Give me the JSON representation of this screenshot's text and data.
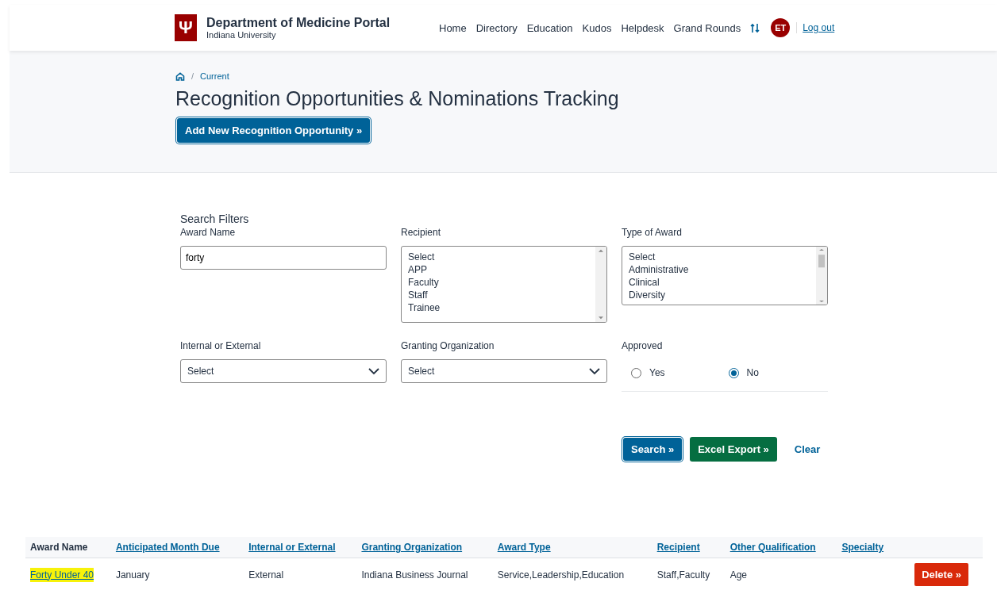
{
  "header": {
    "logo": "Ψ",
    "title": "Department of Medicine Portal",
    "subtitle": "Indiana University",
    "nav": [
      "Home",
      "Directory",
      "Education",
      "Kudos",
      "Helpdesk",
      "Grand Rounds"
    ],
    "avatar": "ET",
    "logout": "Log out"
  },
  "breadcrumb": {
    "separator": "/",
    "current": "Current"
  },
  "page_title": "Recognition Opportunities & Nominations Tracking",
  "add_button": "Add New Recognition Opportunity »",
  "filters": {
    "heading": "Search Filters",
    "award_name": {
      "label": "Award Name",
      "value": "forty"
    },
    "recipient": {
      "label": "Recipient",
      "options": [
        "Select",
        "APP",
        "Faculty",
        "Staff",
        "Trainee"
      ]
    },
    "type_of_award": {
      "label": "Type of Award",
      "options": [
        "Select",
        "Administrative",
        "Clinical",
        "Diversity"
      ]
    },
    "internal_external": {
      "label": "Internal or External",
      "value": "Select"
    },
    "granting_org": {
      "label": "Granting Organization",
      "value": "Select"
    },
    "approved": {
      "label": "Approved",
      "options": [
        {
          "label": "Yes",
          "selected": false
        },
        {
          "label": "No",
          "selected": true
        }
      ]
    }
  },
  "actions": {
    "search": "Search »",
    "export": "Excel Export »",
    "clear": "Clear"
  },
  "table": {
    "columns": [
      {
        "label": "Award Name",
        "sortable": false
      },
      {
        "label": "Anticipated Month Due",
        "sortable": true
      },
      {
        "label": "Internal or External",
        "sortable": true
      },
      {
        "label": "Granting Organization",
        "sortable": true
      },
      {
        "label": "Award Type",
        "sortable": true
      },
      {
        "label": "Recipient",
        "sortable": true
      },
      {
        "label": "Other Qualification",
        "sortable": true
      },
      {
        "label": "Specialty",
        "sortable": true
      }
    ],
    "rows": [
      {
        "highlighted": true,
        "cells": [
          "Forty Under 40",
          "January",
          "External",
          "Indiana Business Journal",
          "Service,Leadership,Education",
          "Staff,Faculty",
          "Age",
          ""
        ],
        "action": "Delete »"
      }
    ]
  }
}
